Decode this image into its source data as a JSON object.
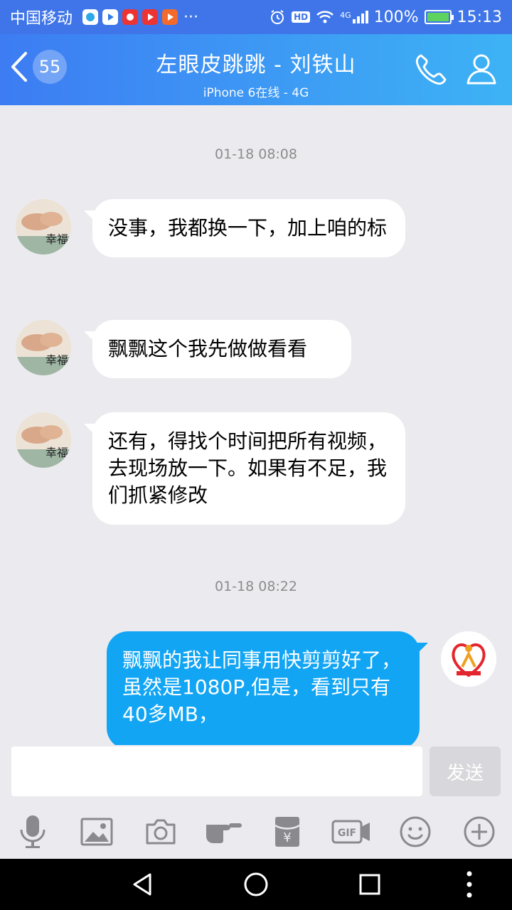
{
  "status_bar": {
    "carrier": "中国移动",
    "dots": "···",
    "hd": "HD",
    "network": "4G",
    "battery": "100%",
    "time": "15:13"
  },
  "header": {
    "unread_count": "55",
    "title": "左眼皮跳跳 - 刘铁山",
    "subtitle": "iPhone 6在线 - 4G"
  },
  "chat": {
    "timestamp_1": "01-18 08:08",
    "msg_1": "没事，我都换一下，加上咱的标",
    "msg_2": "飘飘这个我先做做看看",
    "msg_3": "还有，得找个时间把所有视频，去现场放一下。如果有不足，我们抓紧修改",
    "timestamp_2": "01-18 08:22",
    "msg_4": "飘飘的我让同事用快剪剪好了，虽然是1080P,但是，看到只有40多MB，"
  },
  "input": {
    "value": "",
    "send_label": "发送"
  },
  "toolbar": {
    "gif_label": "GIF",
    "redpacket_label": "¥"
  },
  "colors": {
    "header_start": "#3d7cf3",
    "header_end": "#3db3f5",
    "outgoing_bubble": "#12a5f4",
    "background": "#ebebef"
  }
}
